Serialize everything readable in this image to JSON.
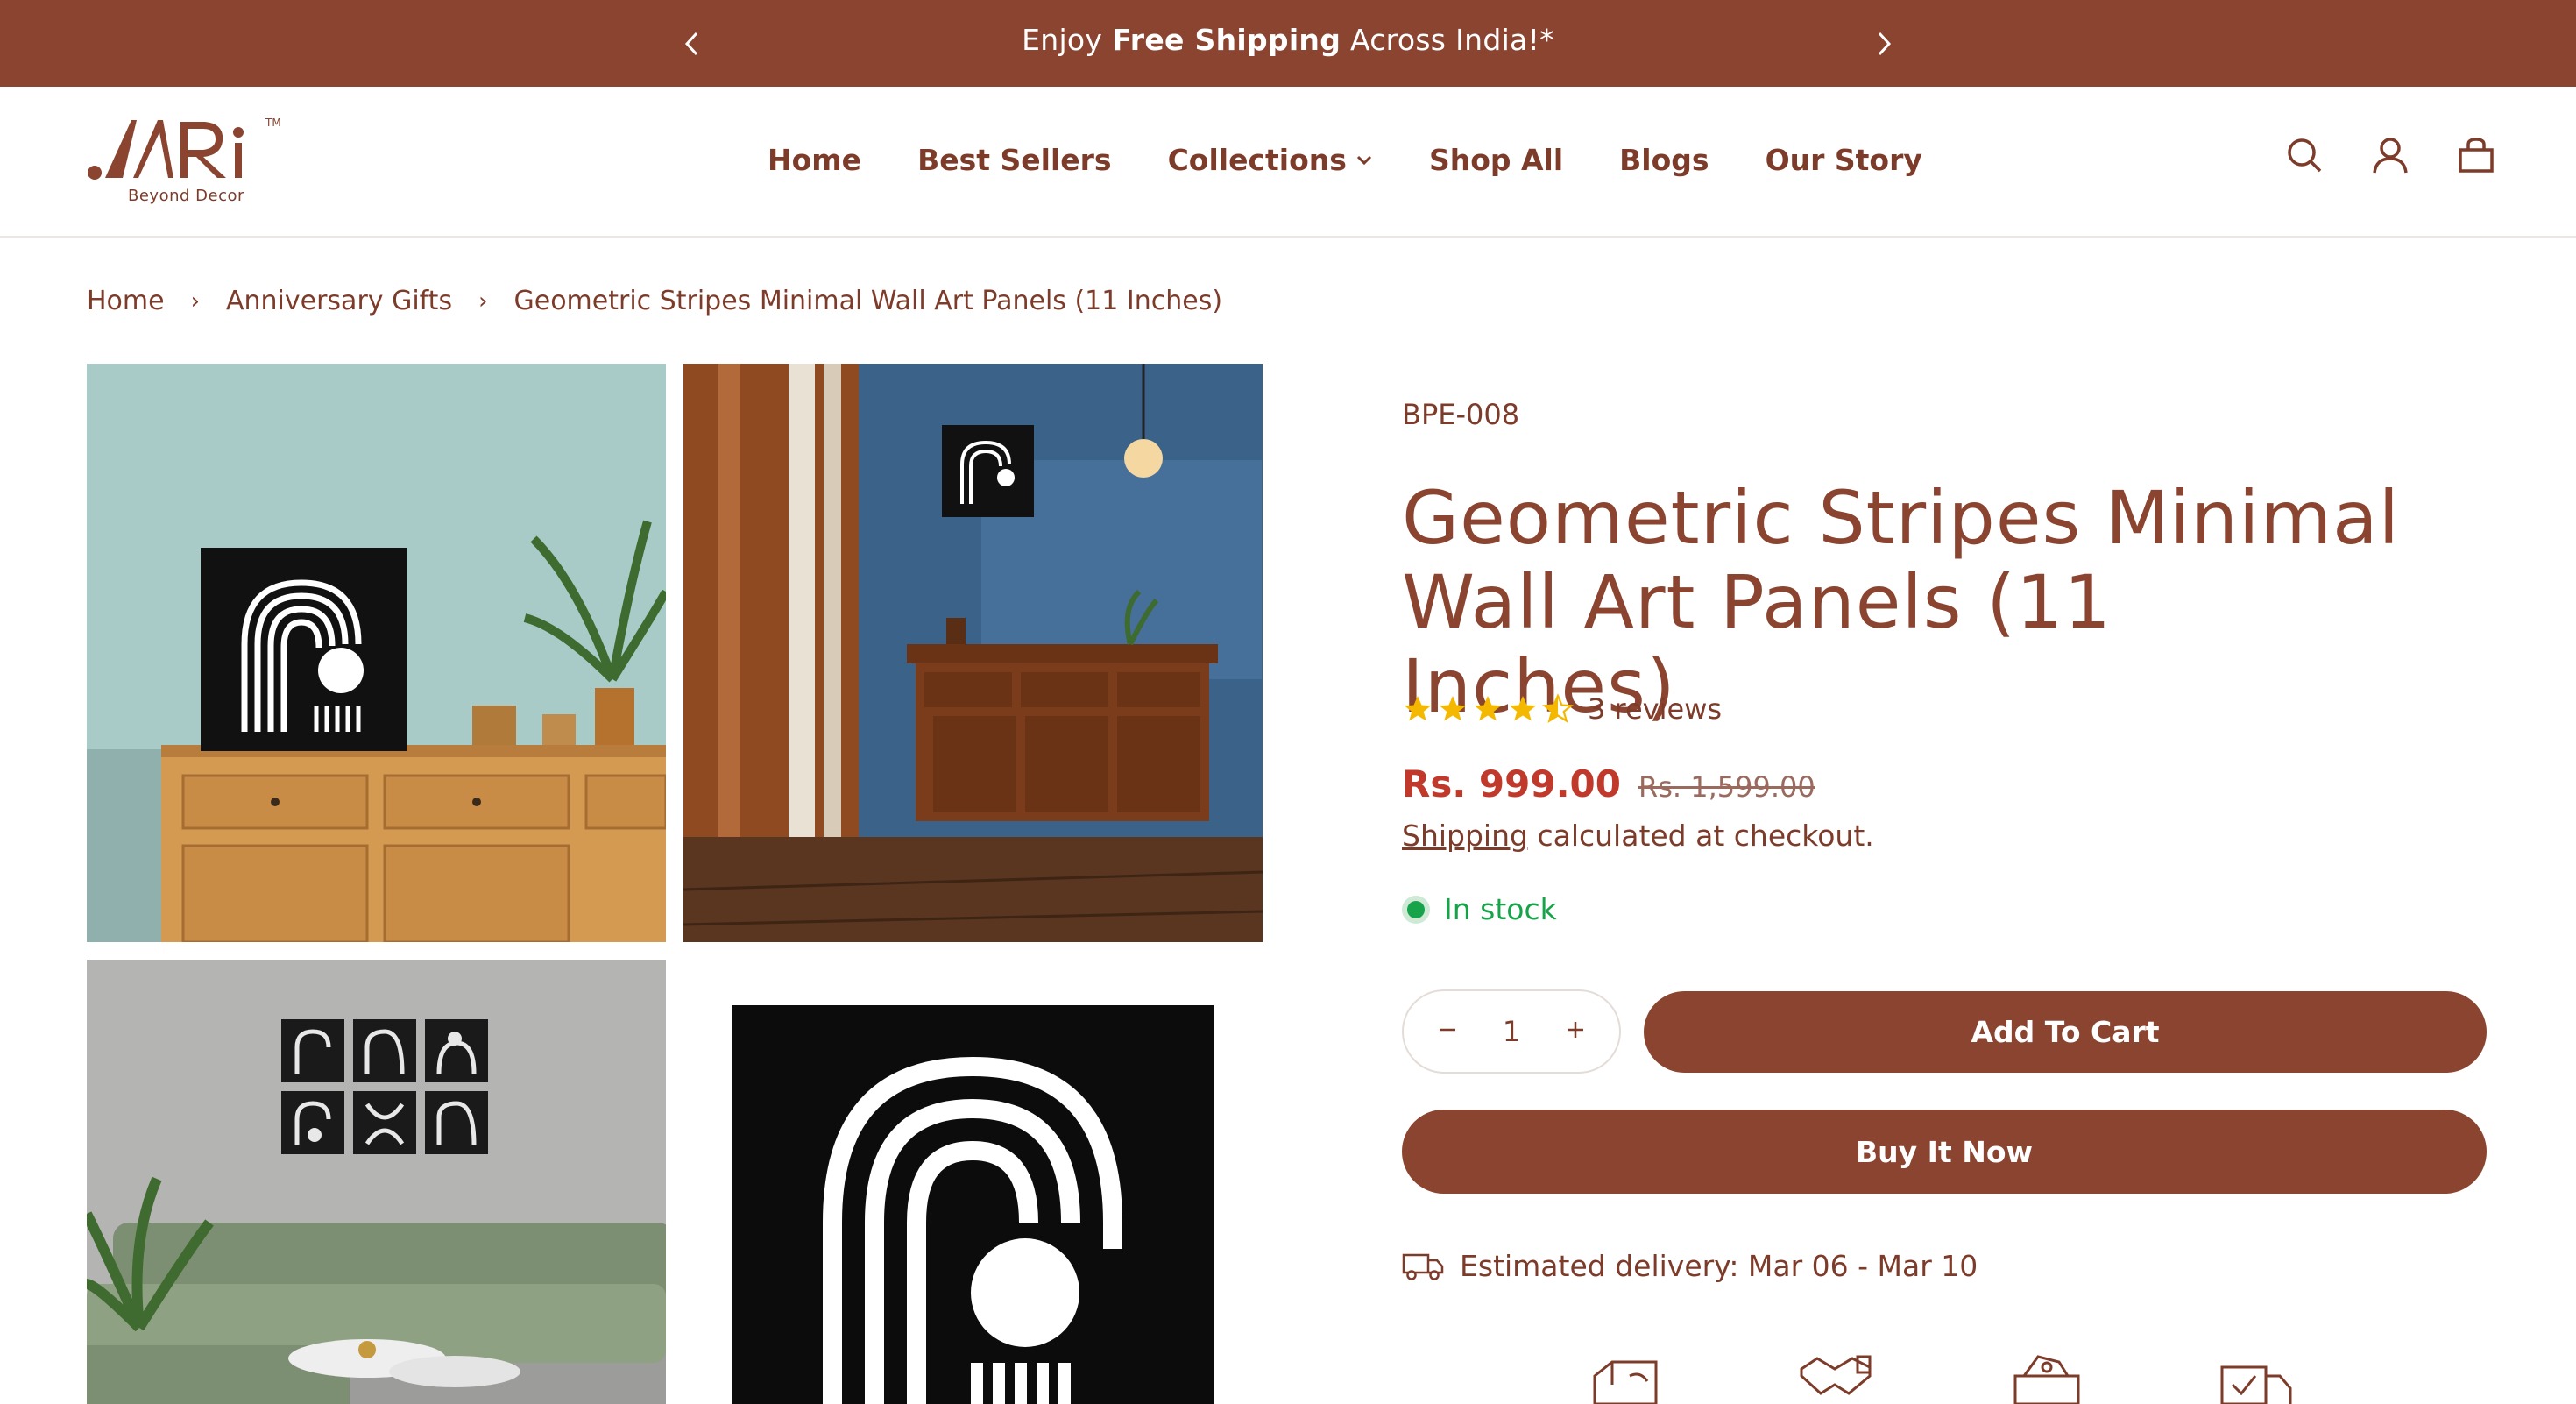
{
  "announcement": {
    "prefix": "Enjoy ",
    "bold": "Free Shipping",
    "suffix": " Across India!*",
    "prev_icon": "chevron-left-icon",
    "next_icon": "chevron-right-icon"
  },
  "header": {
    "logo_mark": ".ARi",
    "logo_tm": "TM",
    "logo_tagline": "Beyond Decor",
    "nav": [
      {
        "label": "Home"
      },
      {
        "label": "Best Sellers"
      },
      {
        "label": "Collections"
      },
      {
        "label": "Shop All"
      },
      {
        "label": "Blogs"
      },
      {
        "label": "Our Story"
      }
    ],
    "icons": [
      "search-icon",
      "account-icon",
      "cart-icon"
    ]
  },
  "breadcrumb": {
    "home": "Home",
    "category": "Anniversary Gifts",
    "current": "Geometric Stripes Minimal Wall Art Panels (11 Inches)",
    "separator": "›"
  },
  "product": {
    "sku": "BPE-008",
    "title": "Geometric Stripes Minimal Wall Art Panels (11 Inches)",
    "rating": 4.5,
    "reviews_label": "3 reviews",
    "price_now": "Rs. 999.00",
    "price_was": "Rs. 1,599.00",
    "shipping_link": "Shipping",
    "shipping_rest": " calculated at checkout.",
    "stock_label": "In stock",
    "quantity": "1",
    "add_to_cart": "Add To Cart",
    "buy_now": "Buy It Now",
    "delivery": "Estimated delivery: Mar 06 - Mar 10",
    "accent_color": "#8a4430",
    "price_color": "#c0392b",
    "stock_color": "#16a34a"
  }
}
